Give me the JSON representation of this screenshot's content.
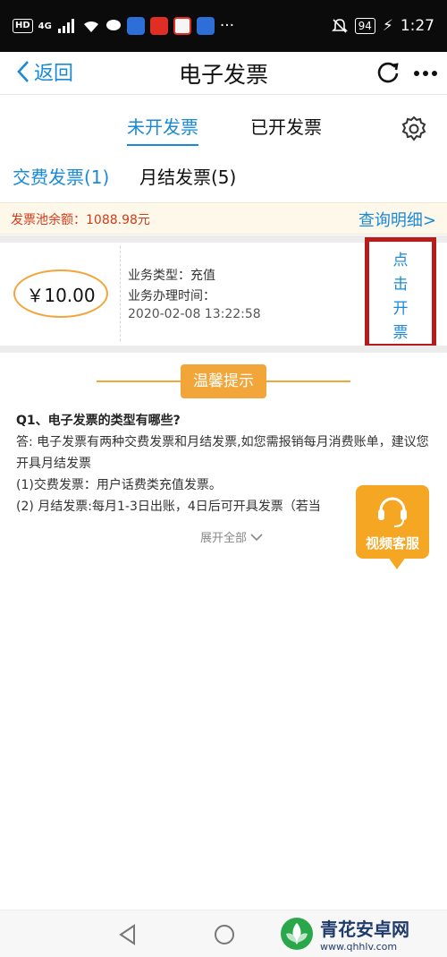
{
  "status_bar": {
    "left_badges": [
      "HD",
      "4G"
    ],
    "battery": "94",
    "time": "1:27"
  },
  "header": {
    "back_label": "返回",
    "title": "电子发票",
    "refresh_icon": "refresh-icon",
    "more_icon": "more-icon"
  },
  "tabs": {
    "active": "未开发票",
    "inactive": "已开发票"
  },
  "sub_tabs": {
    "fee_invoice": "交费发票(1)",
    "monthly_invoice": "月结发票(5)"
  },
  "pool": {
    "balance_label": "发票池余额：1088.98元",
    "query_link": "查询明细>"
  },
  "invoice_card": {
    "amount": "￥10.00",
    "biz_type": "业务类型：充值",
    "biz_time_label": "业务办理时间：",
    "biz_time": "2020-02-08 13:22:58",
    "issue_chars": [
      "点",
      "击",
      "开",
      "票"
    ]
  },
  "tips": {
    "badge": "温馨提示",
    "question": "Q1、电子发票的类型有哪些?",
    "answer": "答: 电子发票有两种交费发票和月结发票,如您需报销每月消费账单，建议您开具月结发票",
    "item1": "(1)交费发票：用户话费类充值发票。",
    "item2": "(2) 月结发票:每月1-3日出账，4日后可开具发票（若当",
    "expand": "展开全部"
  },
  "video_service": {
    "label": "视频客服"
  },
  "watermark": {
    "name": "青花安卓网",
    "url": "www.qhhlv.com"
  },
  "colors": {
    "accent": "#1a8ad6",
    "orange": "#f2a63a",
    "red_text": "#d33a1b",
    "highlight_box": "#b71c1c"
  }
}
